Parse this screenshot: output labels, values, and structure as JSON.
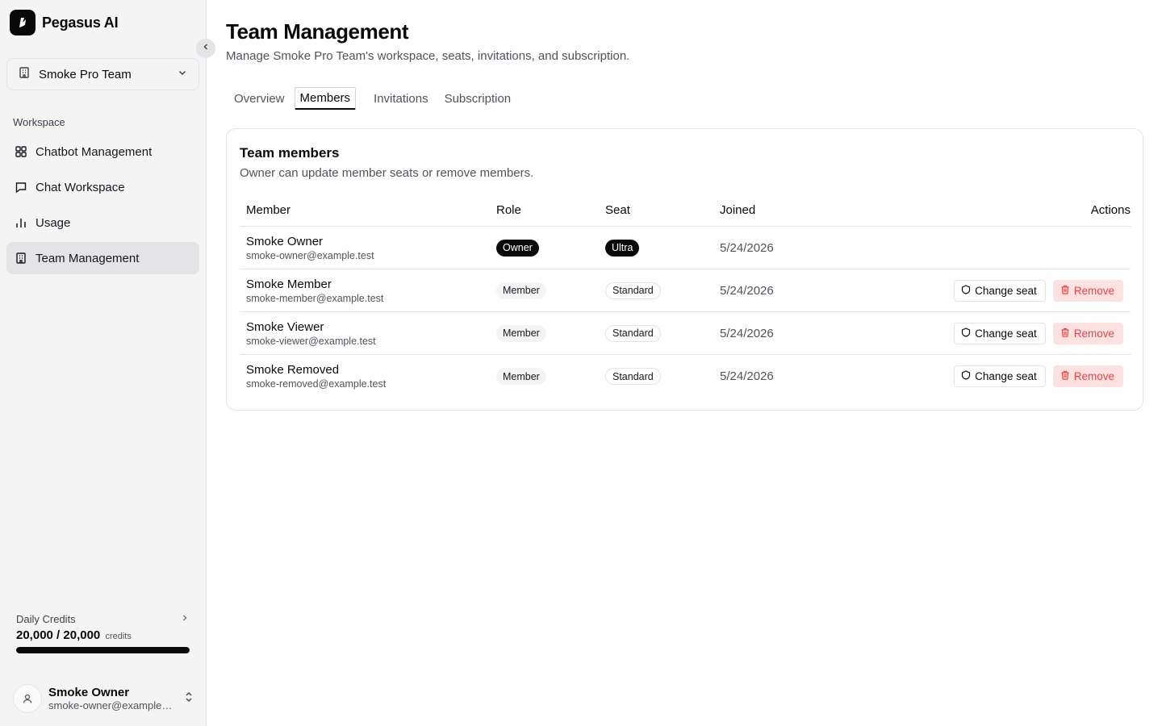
{
  "brand": {
    "name": "Pegasus AI"
  },
  "sidebar": {
    "team": "Smoke Pro Team",
    "section_label": "Workspace",
    "items": [
      {
        "label": "Chatbot Management",
        "icon": "grid-icon"
      },
      {
        "label": "Chat Workspace",
        "icon": "chat-icon"
      },
      {
        "label": "Usage",
        "icon": "bar-chart-icon"
      },
      {
        "label": "Team Management",
        "icon": "building-icon",
        "active": true
      }
    ],
    "credits": {
      "label": "Daily Credits",
      "value": "20,000 / 20,000",
      "unit": "credits",
      "fraction": 1.0
    },
    "user": {
      "name": "Smoke Owner",
      "email": "smoke-owner@example.test"
    }
  },
  "page": {
    "title": "Team Management",
    "subtitle": "Manage Smoke Pro Team's workspace, seats, invitations, and subscription.",
    "tabs": [
      "Overview",
      "Members",
      "Invitations",
      "Subscription"
    ],
    "active_tab": "Members"
  },
  "card": {
    "title": "Team members",
    "description": "Owner can update member seats or remove members.",
    "headers": {
      "member": "Member",
      "role": "Role",
      "seat": "Seat",
      "joined": "Joined",
      "actions": "Actions"
    },
    "actions": {
      "change_seat": "Change seat",
      "remove": "Remove"
    },
    "rows": [
      {
        "name": "Smoke Owner",
        "email": "smoke-owner@example.test",
        "role": "Owner",
        "seat": "Ultra",
        "joined": "5/24/2026"
      },
      {
        "name": "Smoke Member",
        "email": "smoke-member@example.test",
        "role": "Member",
        "seat": "Standard",
        "joined": "5/24/2026"
      },
      {
        "name": "Smoke Viewer",
        "email": "smoke-viewer@example.test",
        "role": "Member",
        "seat": "Standard",
        "joined": "5/24/2026"
      },
      {
        "name": "Smoke Removed",
        "email": "smoke-removed@example.test",
        "role": "Member",
        "seat": "Standard",
        "joined": "5/24/2026"
      }
    ]
  },
  "colors": {
    "accent": "#0a0a0a",
    "danger": "#ef4444",
    "danger_bg": "#fee2e2",
    "sidebar_bg": "#f4f4f5"
  }
}
